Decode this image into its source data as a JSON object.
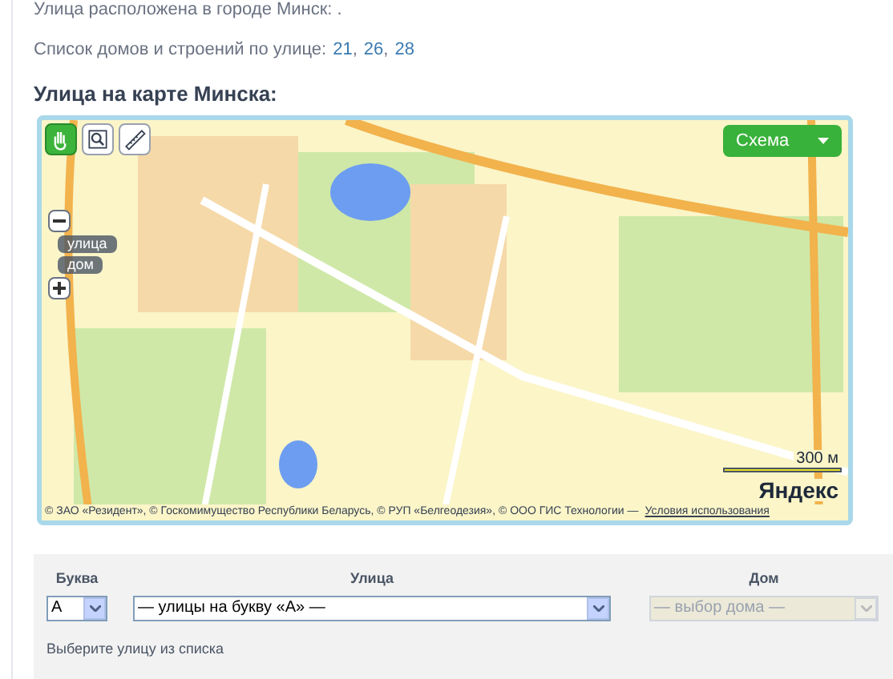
{
  "intro": "Улица расположена в городе Минск: .",
  "houses": {
    "label": "Список домов и строений по улице:",
    "links": [
      "21",
      "26",
      "28"
    ],
    "separator": ","
  },
  "map_heading": "Улица на карте Минска:",
  "map": {
    "tools": [
      {
        "kind": "hand",
        "selected": true
      },
      {
        "kind": "zoom",
        "selected": false
      },
      {
        "kind": "ruler",
        "selected": false
      }
    ],
    "layer_button": "Схема",
    "zoom_levels": [
      "улица",
      "дом"
    ],
    "scale": "300 м",
    "logo": "Яндекс",
    "attribution": "© ЗАО «Резидент», © Госкомимущество Республики Беларусь, © РУП «Белгеодезия», © ООО ГИС Технологии —",
    "terms_link": "Условия использования"
  },
  "form": {
    "fields": [
      {
        "label": "Буква",
        "value": "А",
        "disabled": false
      },
      {
        "label": "Улица",
        "value": "— улицы на букву «А» —",
        "disabled": false
      },
      {
        "label": "Дом",
        "value": "— выбор дома —",
        "disabled": true
      }
    ],
    "hint": "Выберите улицу из списка"
  }
}
